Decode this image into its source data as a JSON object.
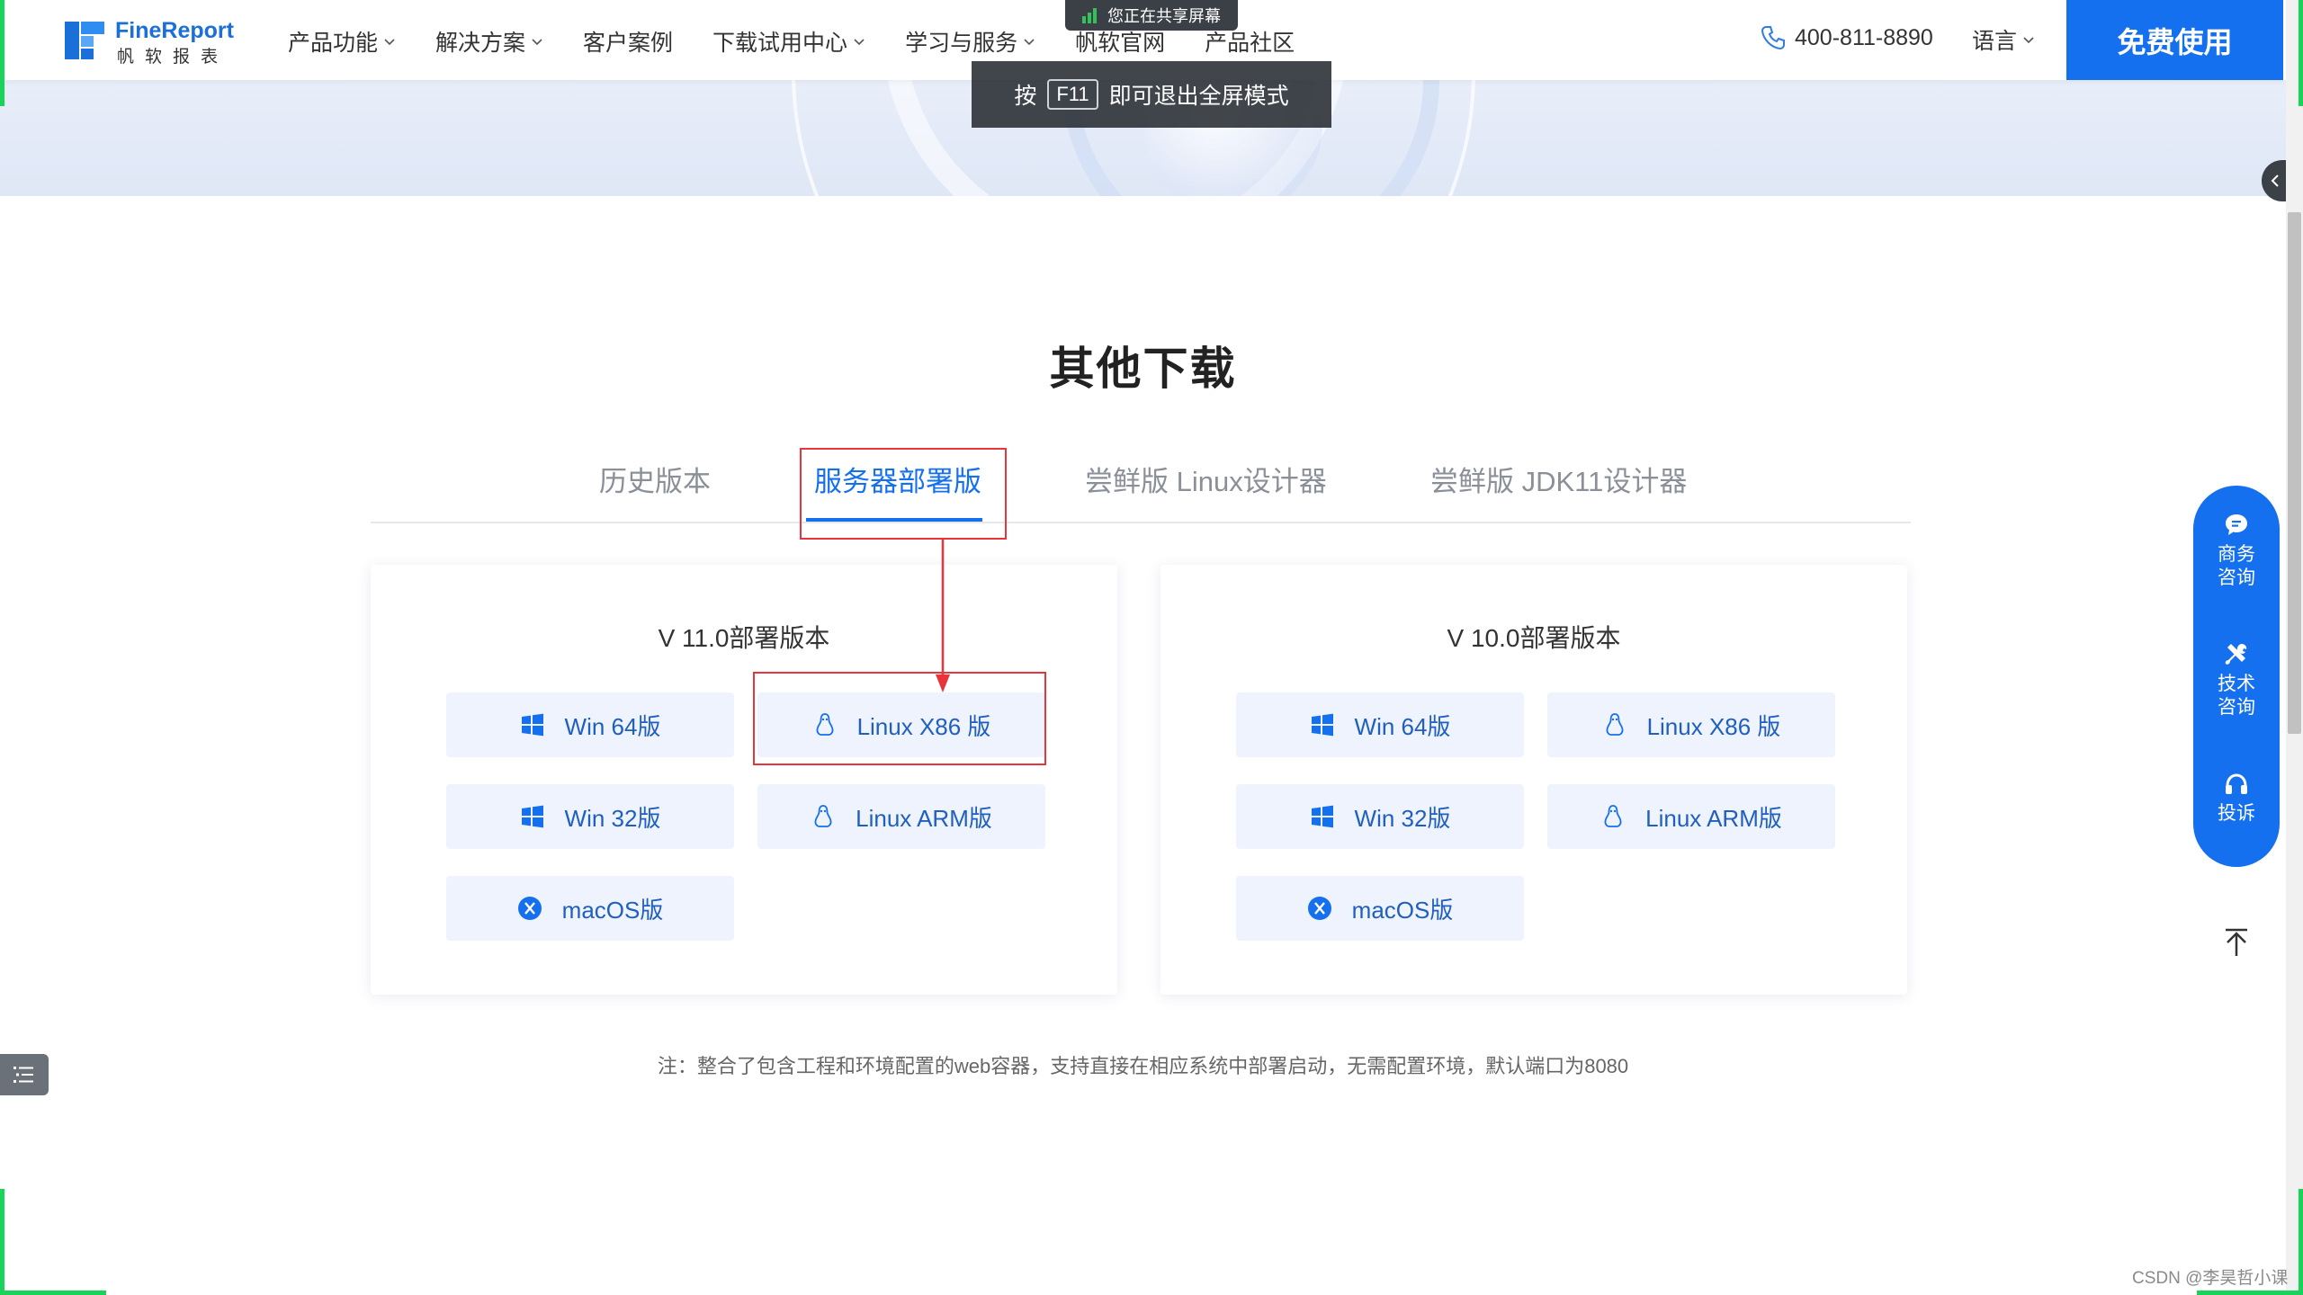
{
  "brand": {
    "name": "FineReport",
    "sub": "帆软报表",
    "color": "#1a6fd8"
  },
  "nav": {
    "items": [
      {
        "label": "产品功能",
        "dropdown": true
      },
      {
        "label": "解决方案",
        "dropdown": true
      },
      {
        "label": "客户案例",
        "dropdown": false
      },
      {
        "label": "下载试用中心",
        "dropdown": true
      },
      {
        "label": "学习与服务",
        "dropdown": true
      },
      {
        "label": "帆软官网",
        "dropdown": false
      },
      {
        "label": "产品社区",
        "dropdown": false
      }
    ],
    "phone": "400-811-8890",
    "language": "语言",
    "cta": "免费使用",
    "accent": "#1570ef"
  },
  "overlays": {
    "share_badge": "您正在共享屏幕",
    "f11_prefix": "按",
    "f11_key": "F11",
    "f11_suffix": "即可退出全屏模式"
  },
  "section": {
    "title": "其他下载",
    "tabs": [
      {
        "label": "历史版本",
        "active": false
      },
      {
        "label": "服务器部署版",
        "active": true
      },
      {
        "label": "尝鲜版 Linux设计器",
        "active": false
      },
      {
        "label": "尝鲜版 JDK11设计器",
        "active": false
      }
    ],
    "cards": [
      {
        "title": "V 11.0部署版本",
        "buttons": [
          {
            "label": "Win 64版",
            "icon": "windows-icon"
          },
          {
            "label": "Linux X86 版",
            "icon": "linux-icon"
          },
          {
            "label": "Win 32版",
            "icon": "windows-icon"
          },
          {
            "label": "Linux ARM版",
            "icon": "linux-icon"
          },
          {
            "label": "macOS版",
            "icon": "macos-icon"
          }
        ]
      },
      {
        "title": "V 10.0部署版本",
        "buttons": [
          {
            "label": "Win 64版",
            "icon": "windows-icon"
          },
          {
            "label": "Linux X86 版",
            "icon": "linux-icon"
          },
          {
            "label": "Win 32版",
            "icon": "windows-icon"
          },
          {
            "label": "Linux ARM版",
            "icon": "linux-icon"
          },
          {
            "label": "macOS版",
            "icon": "macos-icon"
          }
        ]
      }
    ],
    "note": "注：整合了包含工程和环境配置的web容器，支持直接在相应系统中部署启动，无需配置环境，默认端口为8080"
  },
  "float_bar": {
    "items": [
      {
        "label": "商务\n咨询",
        "line1": "商务",
        "line2": "咨询",
        "icon": "chat-icon"
      },
      {
        "label": "技术\n咨询",
        "line1": "技术",
        "line2": "咨询",
        "icon": "tools-icon"
      },
      {
        "label": "投诉",
        "line1": "投诉",
        "line2": "",
        "icon": "headset-icon"
      }
    ]
  },
  "watermark": "CSDN @李昊哲小课",
  "annotation_color": "#e8343a"
}
